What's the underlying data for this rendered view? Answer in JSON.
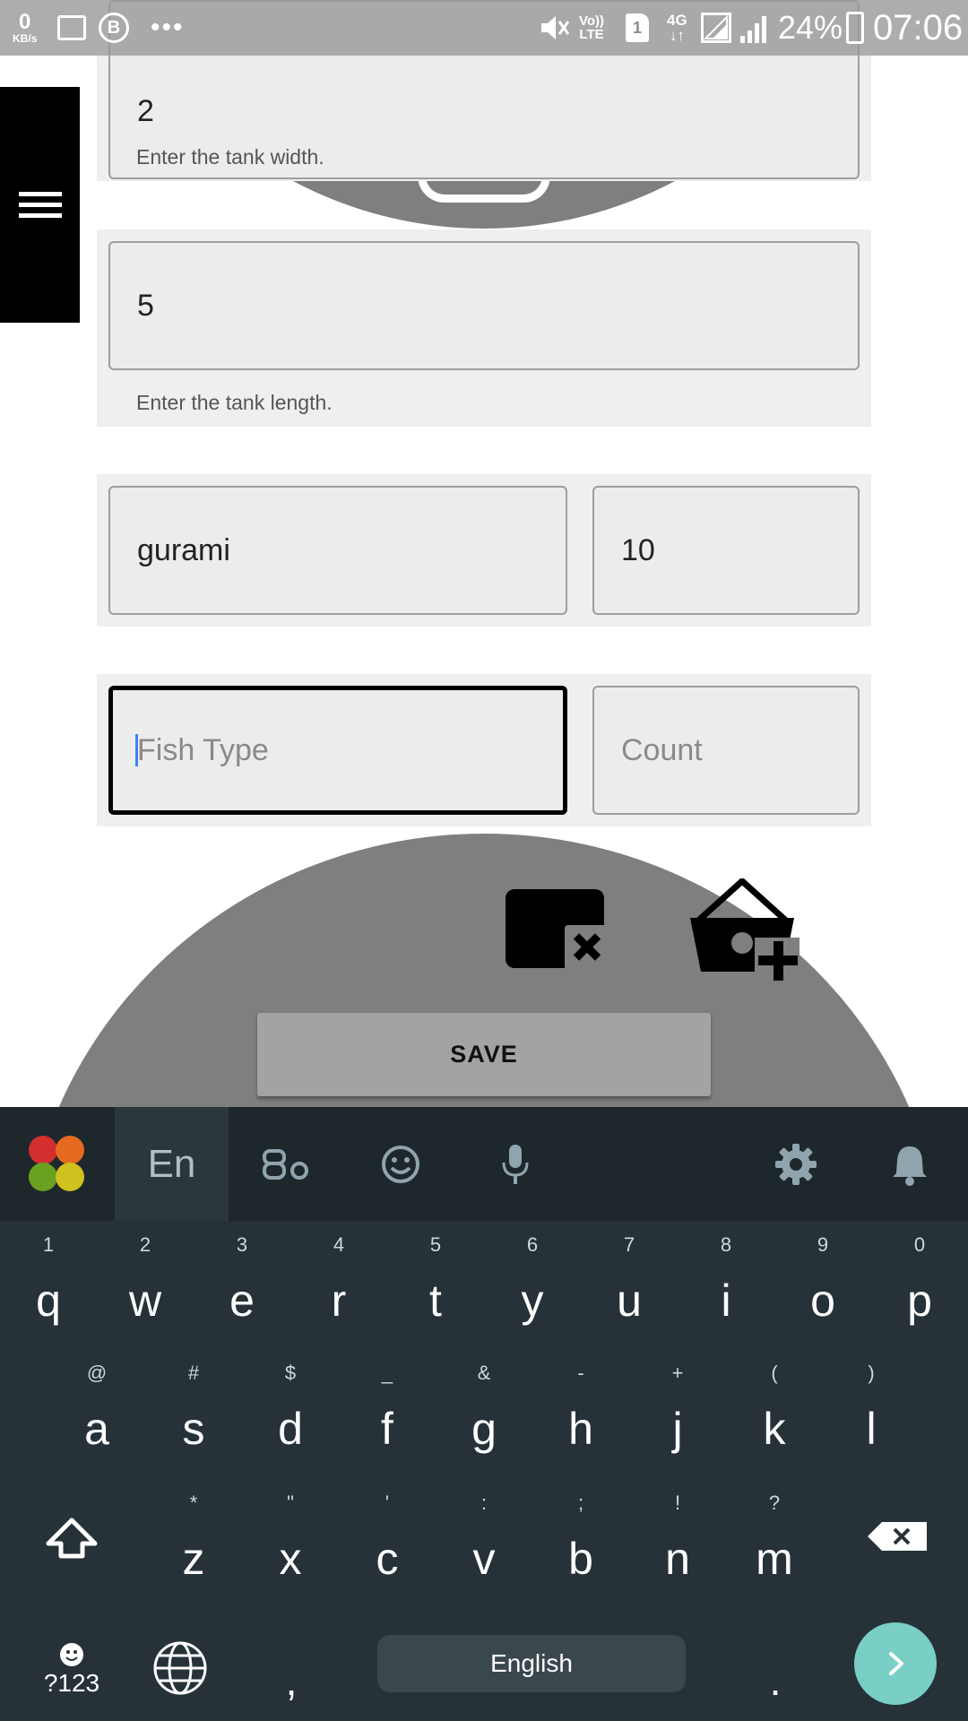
{
  "status_bar": {
    "net_speed": "0",
    "net_unit": "KB/s",
    "b_badge": "B",
    "dots": "•••",
    "volte": [
      "Vo))",
      "LTE"
    ],
    "sim": "1",
    "network": [
      "4G",
      "↓↑"
    ],
    "battery": "24%",
    "time": "07:06"
  },
  "form": {
    "width": {
      "value": "2",
      "helper": "Enter the tank width."
    },
    "length": {
      "value": "5",
      "helper": "Enter the tank length."
    },
    "fish_row": {
      "type": "gurami",
      "count": "10"
    },
    "new_row": {
      "type_placeholder": "Fish Type",
      "count_placeholder": "Count"
    },
    "save_label": "SAVE"
  },
  "keyboard": {
    "lang": "En",
    "rows": [
      [
        {
          "k": "q",
          "h": "1"
        },
        {
          "k": "w",
          "h": "2"
        },
        {
          "k": "e",
          "h": "3"
        },
        {
          "k": "r",
          "h": "4"
        },
        {
          "k": "t",
          "h": "5"
        },
        {
          "k": "y",
          "h": "6"
        },
        {
          "k": "u",
          "h": "7"
        },
        {
          "k": "i",
          "h": "8"
        },
        {
          "k": "o",
          "h": "9"
        },
        {
          "k": "p",
          "h": "0"
        }
      ],
      [
        {
          "k": "a",
          "h": "@"
        },
        {
          "k": "s",
          "h": "#"
        },
        {
          "k": "d",
          "h": "$"
        },
        {
          "k": "f",
          "h": "_"
        },
        {
          "k": "g",
          "h": "&"
        },
        {
          "k": "h",
          "h": "-"
        },
        {
          "k": "j",
          "h": "+"
        },
        {
          "k": "k",
          "h": "("
        },
        {
          "k": "l",
          "h": ")"
        }
      ],
      [
        {
          "k": "z",
          "h": "*"
        },
        {
          "k": "x",
          "h": "\""
        },
        {
          "k": "c",
          "h": "'"
        },
        {
          "k": "v",
          "h": ":"
        },
        {
          "k": "b",
          "h": ";"
        },
        {
          "k": "n",
          "h": "!"
        },
        {
          "k": "m",
          "h": "?"
        }
      ]
    ],
    "symbols_label": "?123",
    "comma": ",",
    "space_label": "English",
    "period": "."
  },
  "colors": {
    "accent_enter": "#79cec5",
    "logo": [
      "#d32f2f",
      "#e66a1f",
      "#6aa121",
      "#cfc21e"
    ]
  }
}
